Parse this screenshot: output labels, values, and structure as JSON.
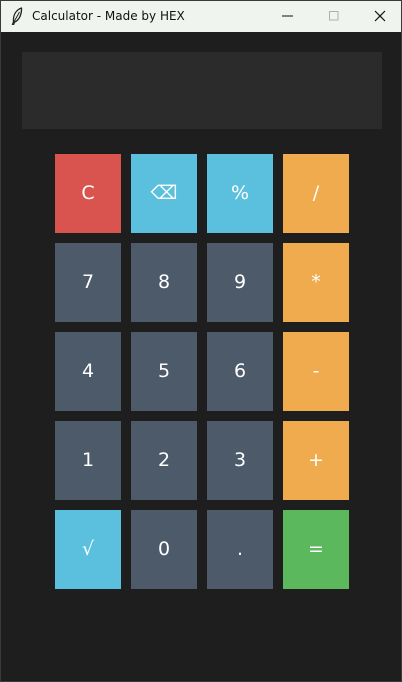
{
  "window": {
    "title": "Calculator - Made by HEX",
    "icon": "feather-icon"
  },
  "display": {
    "value": ""
  },
  "colors": {
    "background": "#1e1e1e",
    "display": "#2b2b2b",
    "number_key": "#4c5a6a",
    "operator_key": "#efab4e",
    "clear_key": "#d9534f",
    "special_key": "#5bc0de",
    "equals_key": "#5cb85c"
  },
  "keys": {
    "clear": "C",
    "backspace": "⌫",
    "percent": "%",
    "divide": "/",
    "seven": "7",
    "eight": "8",
    "nine": "9",
    "multiply": "*",
    "four": "4",
    "five": "5",
    "six": "6",
    "subtract": "-",
    "one": "1",
    "two": "2",
    "three": "3",
    "add": "+",
    "sqrt": "√",
    "zero": "0",
    "decimal": ".",
    "equals": "="
  }
}
